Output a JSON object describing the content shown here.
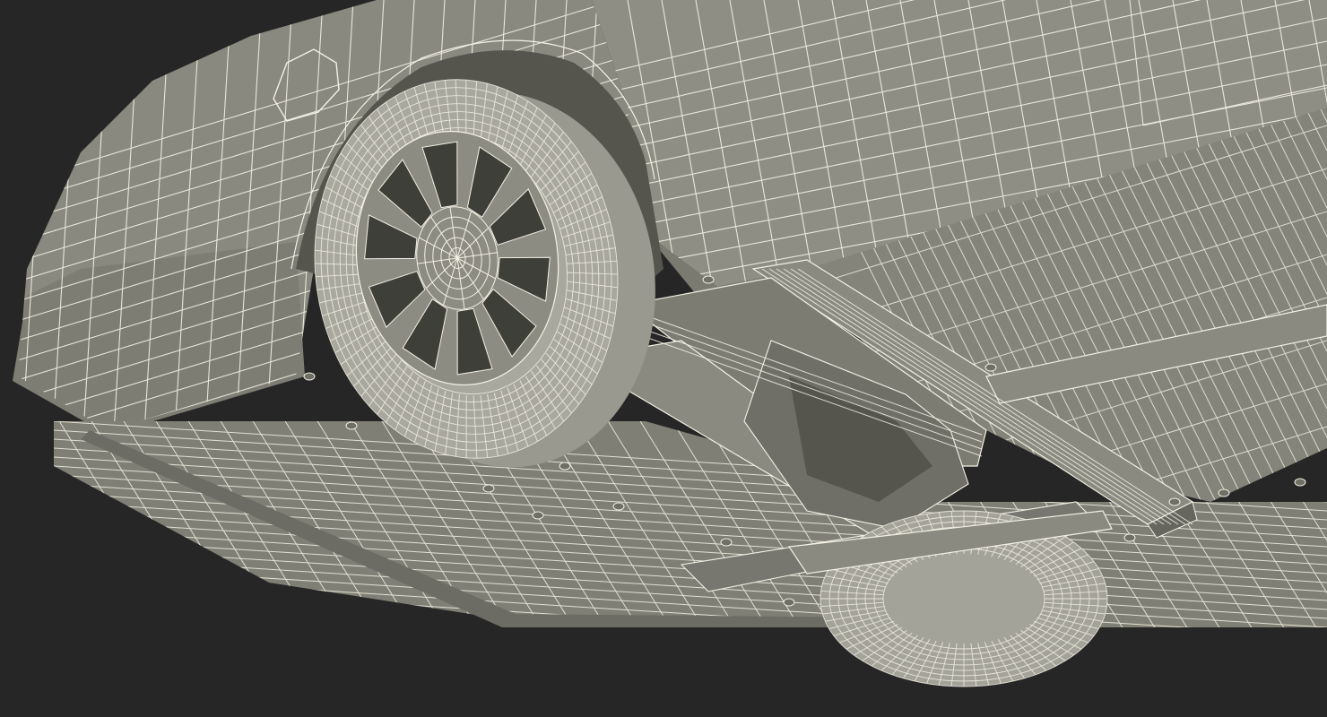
{
  "scene": {
    "subject": "car-underside-wireframe-render",
    "colors": {
      "background": "#262626",
      "body_fill": "#8c8c82",
      "body_dark": "#6f6f66",
      "body_shadow": "#55554e",
      "wire": "#f4f1e4",
      "tire_fill": "#a4a399",
      "hub_dark": "#3f3f3a"
    }
  }
}
